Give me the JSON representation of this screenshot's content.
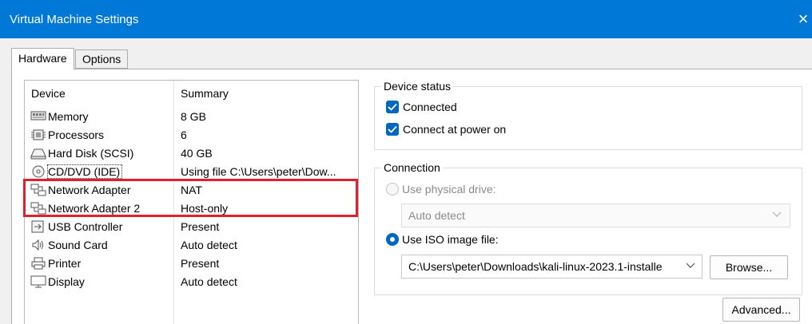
{
  "window": {
    "title": "Virtual Machine Settings",
    "close_glyph": "×"
  },
  "tabs": [
    {
      "label": "Hardware"
    },
    {
      "label": "Options"
    }
  ],
  "device_list": {
    "headers": {
      "device": "Device",
      "summary": "Summary"
    },
    "rows": [
      {
        "name": "Memory",
        "summary": "8 GB",
        "icon": "memory-icon"
      },
      {
        "name": "Processors",
        "summary": "6",
        "icon": "processor-icon"
      },
      {
        "name": "Hard Disk (SCSI)",
        "summary": "40 GB",
        "icon": "hard-disk-icon"
      },
      {
        "name": "CD/DVD (IDE)",
        "summary": "Using file C:\\Users\\peter\\Dow...",
        "icon": "cd-dvd-icon"
      },
      {
        "name": "Network Adapter",
        "summary": "NAT",
        "icon": "network-adapter-icon"
      },
      {
        "name": "Network Adapter 2",
        "summary": "Host-only",
        "icon": "network-adapter-icon"
      },
      {
        "name": "USB Controller",
        "summary": "Present",
        "icon": "usb-icon"
      },
      {
        "name": "Sound Card",
        "summary": "Auto detect",
        "icon": "sound-icon"
      },
      {
        "name": "Printer",
        "summary": "Present",
        "icon": "printer-icon"
      },
      {
        "name": "Display",
        "summary": "Auto detect",
        "icon": "display-icon"
      }
    ]
  },
  "device_status": {
    "legend": "Device status",
    "connected": {
      "label": "Connected",
      "checked": true
    },
    "connect_at_power_on": {
      "label": "Connect at power on",
      "checked": true
    }
  },
  "connection": {
    "legend": "Connection",
    "use_physical_drive": {
      "label": "Use physical drive:",
      "selected": false,
      "enabled": false
    },
    "physical_drive_select": {
      "value": "Auto detect"
    },
    "use_iso_image": {
      "label": "Use ISO image file:",
      "selected": true
    },
    "iso_path_select": {
      "value": "C:\\Users\\peter\\Downloads\\kali-linux-2023.1-installe"
    },
    "browse_button": "Browse...",
    "advanced_button": "Advanced..."
  },
  "colors": {
    "titlebar": "#0078d7",
    "accent": "#0067c0",
    "highlight_box": "#e0202c"
  }
}
